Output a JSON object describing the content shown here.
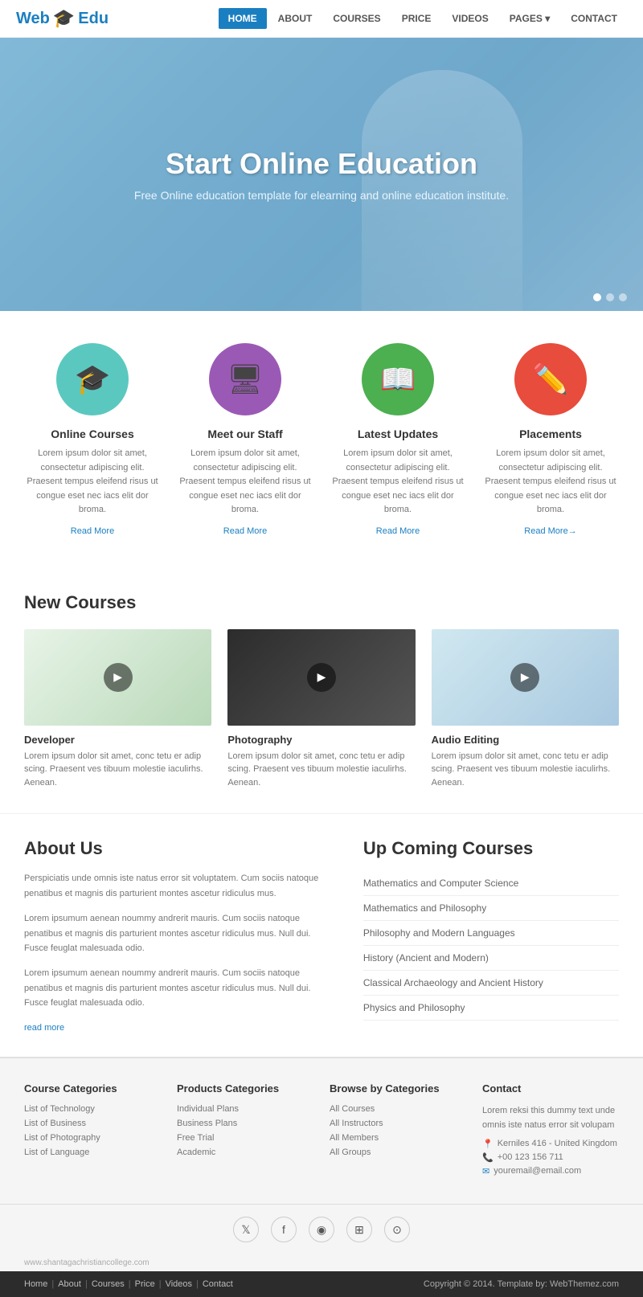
{
  "brand": {
    "name_part1": "Web",
    "name_part2": "Edu",
    "icon": "🎓"
  },
  "nav": {
    "items": [
      {
        "label": "HOME",
        "active": true
      },
      {
        "label": "ABOUT",
        "active": false
      },
      {
        "label": "COURSES",
        "active": false
      },
      {
        "label": "PRICE",
        "active": false
      },
      {
        "label": "VIDEOS",
        "active": false
      },
      {
        "label": "PAGES ▾",
        "active": false
      },
      {
        "label": "CONTACT",
        "active": false
      }
    ]
  },
  "hero": {
    "title": "Start Online Education",
    "subtitle": "Free Online education template for elearning and online education institute.",
    "dots": [
      true,
      false,
      false
    ]
  },
  "features": [
    {
      "icon": "🎓",
      "icon_class": "icon-teal",
      "title": "Online Courses",
      "text": "Lorem ipsum dolor sit amet, consectetur adipiscing elit. Praesent tempus eleifend risus ut congue eset nec iacs elit dor broma.",
      "link": "Read More"
    },
    {
      "icon": "🖥",
      "icon_class": "icon-purple",
      "title": "Meet our Staff",
      "text": "Lorem ipsum dolor sit amet, consectetur adipiscing elit. Praesent tempus eleifend risus ut congue eset nec iacs elit dor broma.",
      "link": "Read More"
    },
    {
      "icon": "📖",
      "icon_class": "icon-green",
      "title": "Latest Updates",
      "text": "Lorem ipsum dolor sit amet, consectetur adipiscing elit. Praesent tempus eleifend risus ut congue eset nec iacs elit dor broma.",
      "link": "Read More"
    },
    {
      "icon": "✏️",
      "icon_class": "icon-red",
      "title": "Placements",
      "text": "Lorem ipsum dolor sit amet, consectetur adipiscing elit. Praesent tempus eleifend risus ut congue eset nec iacs elit dor broma.",
      "link": "Read More→"
    }
  ],
  "new_courses": {
    "title": "New Courses",
    "items": [
      {
        "thumb_class": "course-thumb-1",
        "title": "Developer",
        "text": "Lorem ipsum dolor sit amet, conc tetu er adip scing. Praesent ves tibuum molestie iaculirhs. Aenean."
      },
      {
        "thumb_class": "course-thumb-2",
        "title": "Photography",
        "text": "Lorem ipsum dolor sit amet, conc tetu er adip scing. Praesent ves tibuum molestie iaculirhs. Aenean."
      },
      {
        "thumb_class": "course-thumb-3",
        "title": "Audio Editing",
        "text": "Lorem ipsum dolor sit amet, conc tetu er adip scing. Praesent ves tibuum molestie iaculirhs. Aenean."
      }
    ]
  },
  "about": {
    "title": "About Us",
    "paragraphs": [
      "Perspiciatis unde omnis iste natus error sit voluptatem. Cum sociis natoque penatibus et magnis dis parturient montes ascetur ridiculus mus.",
      "Lorem ipsumum aenean noummy andrerit mauris. Cum sociis natoque penatibus et magnis dis parturient montes ascetur ridiculus mus. Null dui. Fusce feuglat malesuada odio.",
      "Lorem ipsumum aenean noummy andrerit mauris. Cum sociis natoque penatibus et magnis dis parturient montes ascetur ridiculus mus. Null dui. Fusce feuglat malesuada odio."
    ],
    "read_more": "read more"
  },
  "upcoming": {
    "title": "Up Coming Courses",
    "items": [
      "Mathematics and Computer Science",
      "Mathematics and Philosophy",
      "Philosophy and Modern Languages",
      "History (Ancient and Modern)",
      "Classical Archaeology and Ancient History",
      "Physics and Philosophy"
    ]
  },
  "footer": {
    "columns": [
      {
        "title": "Course Categories",
        "links": [
          "List of Technology",
          "List of Business",
          "List of Photography",
          "List of Language"
        ]
      },
      {
        "title": "Products Categories",
        "links": [
          "Individual Plans",
          "Business Plans",
          "Free Trial",
          "Academic"
        ]
      },
      {
        "title": "Browse by Categories",
        "links": [
          "All Courses",
          "All Instructors",
          "All Members",
          "All Groups"
        ]
      },
      {
        "title": "Contact",
        "text": "Lorem reksi this dummy text unde omnis iste natus error sit volupam",
        "address": "Kerniles 416 - United Kingdom",
        "phone": "+00 123 156 711",
        "email": "youremail@email.com"
      }
    ],
    "social_icons": [
      "𝕏",
      "f",
      "⊕",
      "▣",
      "⊙"
    ],
    "url": "www.shantagachristiancollege.com",
    "bottom_links": [
      "Home",
      "About",
      "Courses",
      "Price",
      "Videos",
      "Contact"
    ],
    "copyright": "Copyright © 2014. Template by: WebThemez.com"
  }
}
